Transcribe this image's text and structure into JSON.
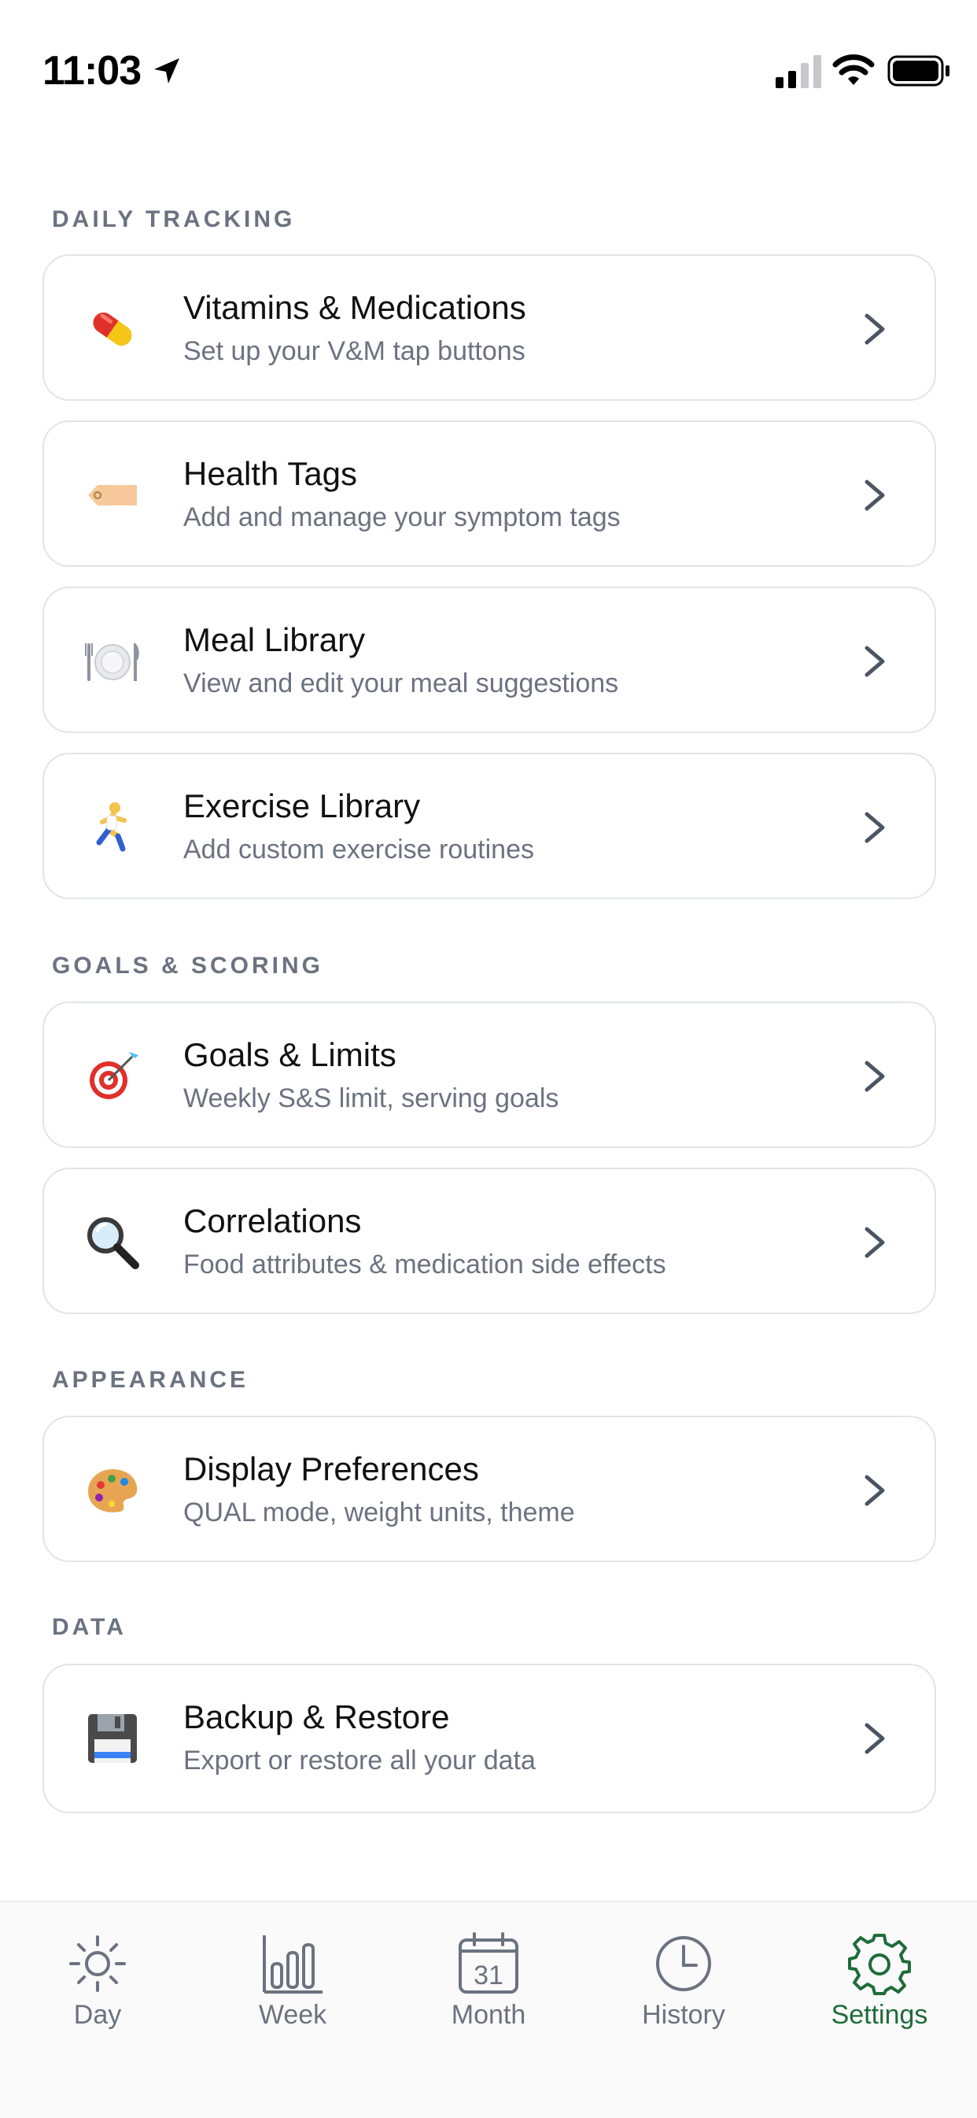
{
  "status_bar": {
    "time": "11:03"
  },
  "sections": [
    {
      "title": "DAILY TRACKING",
      "items": [
        {
          "title": "Vitamins & Medications",
          "subtitle": "Set up your V&M tap buttons",
          "icon": "pill-icon"
        },
        {
          "title": "Health Tags",
          "subtitle": "Add and manage your symptom tags",
          "icon": "tag-icon"
        },
        {
          "title": "Meal Library",
          "subtitle": "View and edit your meal suggestions",
          "icon": "plate-icon"
        },
        {
          "title": "Exercise Library",
          "subtitle": "Add custom exercise routines",
          "icon": "runner-icon"
        }
      ]
    },
    {
      "title": "GOALS & SCORING",
      "items": [
        {
          "title": "Goals & Limits",
          "subtitle": "Weekly S&S limit, serving goals",
          "icon": "target-icon"
        },
        {
          "title": "Correlations",
          "subtitle": "Food attributes & medication side effects",
          "icon": "magnifier-icon"
        }
      ]
    },
    {
      "title": "APPEARANCE",
      "items": [
        {
          "title": "Display Preferences",
          "subtitle": "QUAL mode, weight units, theme",
          "icon": "palette-icon"
        }
      ]
    },
    {
      "title": "DATA",
      "items": [
        {
          "title": "Backup & Restore",
          "subtitle": "Export or restore all your data",
          "icon": "floppy-disk-icon"
        }
      ]
    }
  ],
  "tab_bar": {
    "tabs": [
      {
        "label": "Day",
        "icon": "sun-icon"
      },
      {
        "label": "Week",
        "icon": "bar-chart-icon"
      },
      {
        "label": "Month",
        "icon": "calendar-icon",
        "calendar_day": "31"
      },
      {
        "label": "History",
        "icon": "clock-icon"
      },
      {
        "label": "Settings",
        "icon": "gear-icon"
      }
    ],
    "active": "Settings",
    "active_color": "#1f6b3a",
    "inactive_color": "#6b7280"
  }
}
